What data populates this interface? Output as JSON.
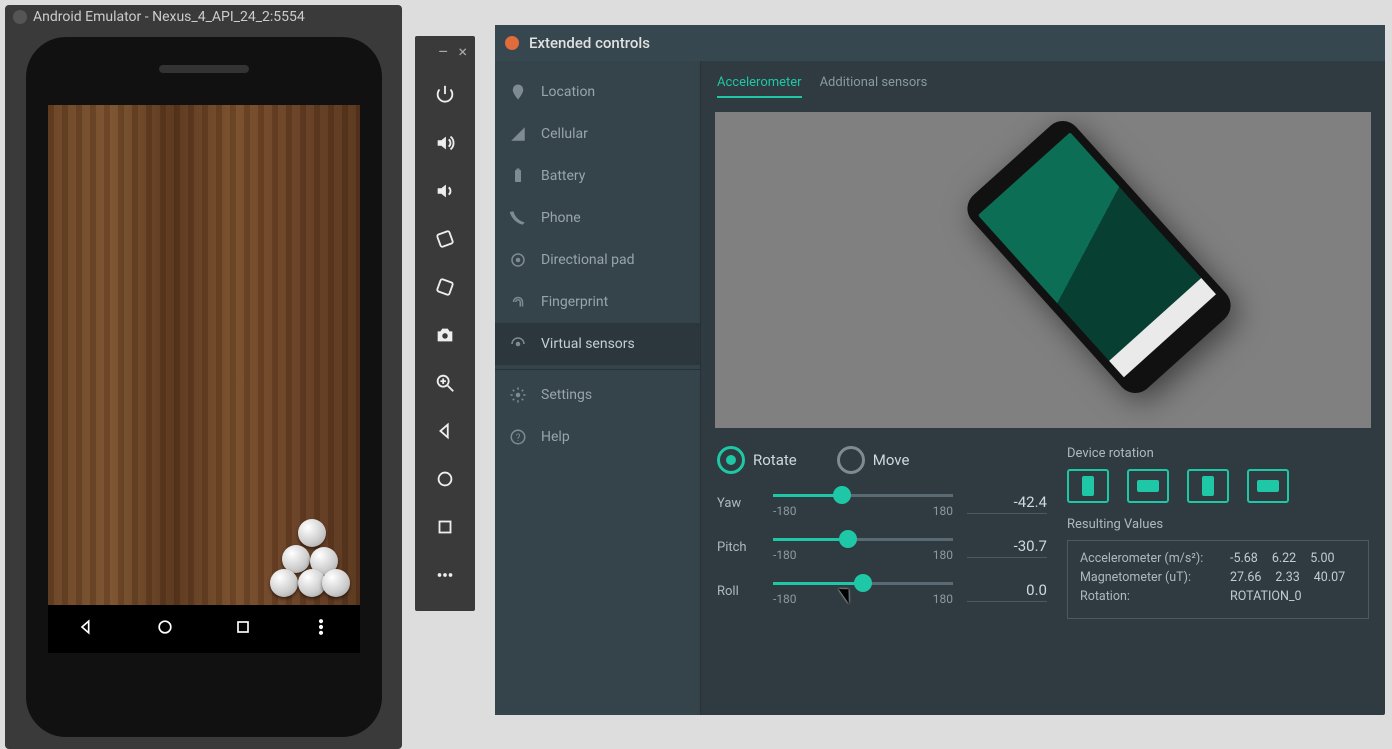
{
  "emulator": {
    "title": "Android Emulator - Nexus_4_API_24_2:5554"
  },
  "toolbar": {
    "minimize": "–",
    "close": "×"
  },
  "ext": {
    "title": "Extended controls",
    "sidebar": [
      {
        "id": "location",
        "label": "Location"
      },
      {
        "id": "cellular",
        "label": "Cellular"
      },
      {
        "id": "battery",
        "label": "Battery"
      },
      {
        "id": "phone",
        "label": "Phone"
      },
      {
        "id": "dpad",
        "label": "Directional pad"
      },
      {
        "id": "fingerprint",
        "label": "Fingerprint"
      },
      {
        "id": "virtual-sensors",
        "label": "Virtual sensors"
      },
      {
        "id": "settings",
        "label": "Settings"
      },
      {
        "id": "help",
        "label": "Help"
      }
    ],
    "tabs": {
      "accel": "Accelerometer",
      "additional": "Additional sensors"
    },
    "mode": {
      "rotate": "Rotate",
      "move": "Move"
    },
    "sliders": {
      "yaw": {
        "label": "Yaw",
        "min": "-180",
        "max": "180",
        "value": "-42.4",
        "pct": 38.2
      },
      "pitch": {
        "label": "Pitch",
        "min": "-180",
        "max": "180",
        "value": "-30.7",
        "pct": 41.5
      },
      "roll": {
        "label": "Roll",
        "min": "-180",
        "max": "180",
        "value": "0.0",
        "pct": 50.0
      }
    },
    "rotation": {
      "title": "Device rotation"
    },
    "results": {
      "title": "Resulting Values",
      "accel_label": "Accelerometer (m/s²):",
      "accel": {
        "x": "-5.68",
        "y": "6.22",
        "z": "5.00"
      },
      "mag_label": "Magnetometer (uT):",
      "mag": {
        "x": "27.66",
        "y": "2.33",
        "z": "40.07"
      },
      "rot_label": "Rotation:",
      "rot_value": "ROTATION_0"
    }
  }
}
